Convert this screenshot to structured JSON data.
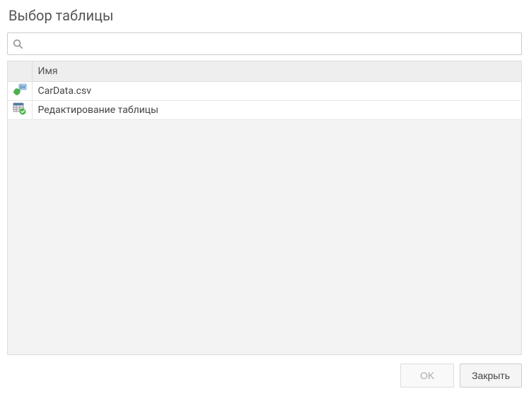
{
  "dialog": {
    "title": "Выбор таблицы"
  },
  "search": {
    "value": "",
    "placeholder": ""
  },
  "table": {
    "header": {
      "icon_col": "",
      "name_col": "Имя"
    },
    "rows": [
      {
        "icon": "csv-file-icon",
        "name": "CarData.csv"
      },
      {
        "icon": "table-edit-icon",
        "name": "Редактирование таблицы"
      }
    ]
  },
  "buttons": {
    "ok": "OK",
    "close": "Закрыть"
  }
}
